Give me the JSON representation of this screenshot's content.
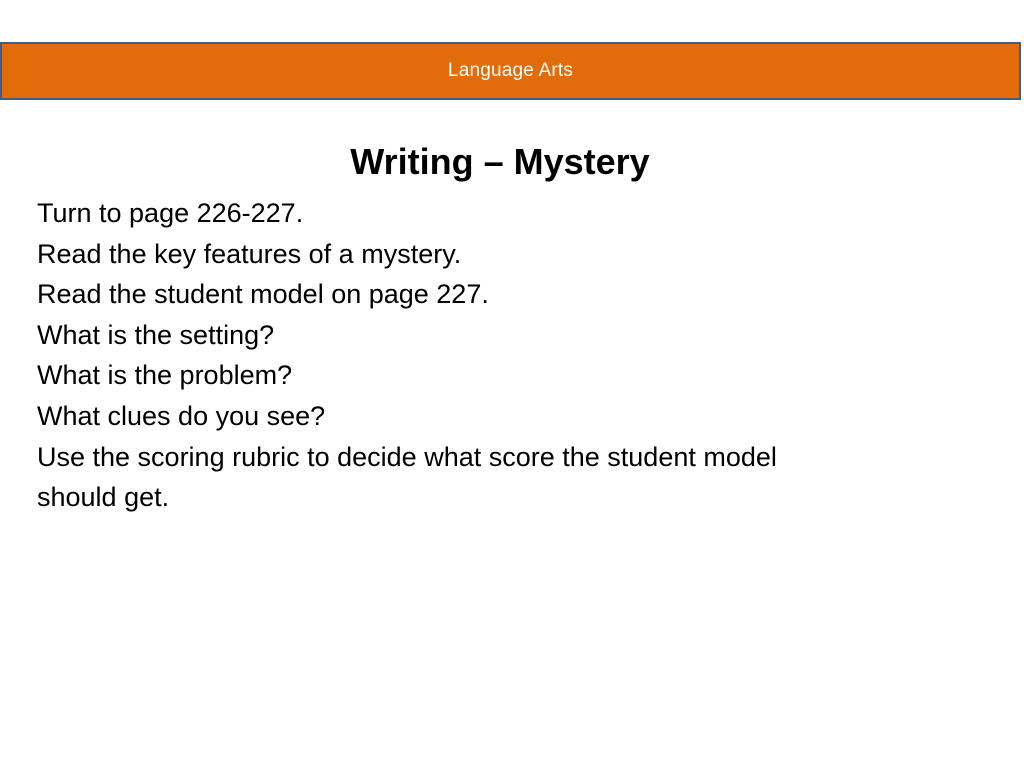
{
  "banner": {
    "label": "Language Arts",
    "color": "#e36c0a",
    "border_color": "#3f5d8a"
  },
  "title": "Writing – Mystery",
  "lines": [
    "Turn to page 226-227.",
    "Read the key features of a mystery.",
    "Read the student model on page 227.",
    "What is the setting?",
    "What is the problem?",
    "What clues do you see?",
    "Use the scoring rubric to decide what score the student model",
    "should get."
  ]
}
